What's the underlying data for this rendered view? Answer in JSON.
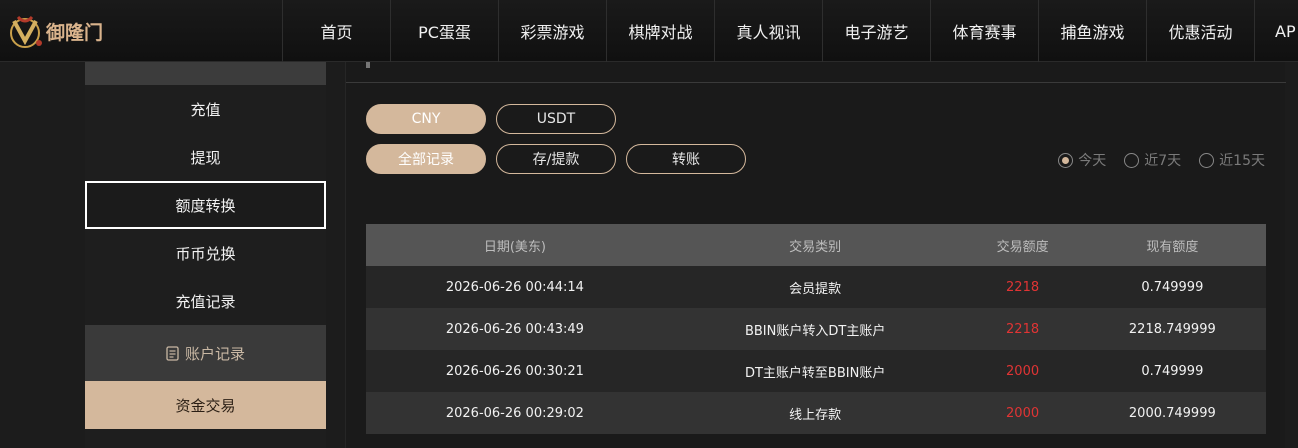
{
  "brand": {
    "name": "御隆门",
    "logo_icon": "brand-emblem-icon"
  },
  "nav": {
    "items": [
      "首页",
      "PC蛋蛋",
      "彩票游戏",
      "棋牌对战",
      "真人视讯",
      "电子游艺",
      "体育赛事",
      "捕鱼游戏",
      "优惠活动",
      "AP"
    ]
  },
  "sidebar": {
    "items": [
      "充值",
      "提现",
      "额度转换",
      "币币兑换",
      "充值记录"
    ],
    "section": {
      "label": "账户记录",
      "icon": "document-icon"
    },
    "section_items": [
      "资金交易"
    ]
  },
  "currency_tabs": [
    "CNY",
    "USDT"
  ],
  "filter_tabs": [
    "全部记录",
    "存/提款",
    "转账"
  ],
  "date_filters": [
    "今天",
    "近7天",
    "近15天"
  ],
  "table": {
    "columns": [
      "日期(美东)",
      "交易类别",
      "交易额度",
      "现有额度"
    ],
    "rows": [
      {
        "date": "2026-06-26 00:44:14",
        "type": "会员提款",
        "amount": "2218",
        "balance": "0.749999"
      },
      {
        "date": "2026-06-26 00:43:49",
        "type": "BBIN账户转入DT主账户",
        "amount": "2218",
        "balance": "2218.749999"
      },
      {
        "date": "2026-06-26 00:30:21",
        "type": "DT主账户转至BBIN账户",
        "amount": "2000",
        "balance": "0.749999"
      },
      {
        "date": "2026-06-26 00:29:02",
        "type": "线上存款",
        "amount": "2000",
        "balance": "2000.749999"
      }
    ]
  },
  "colors": {
    "accent": "#d4b89c",
    "amount": "#e03434"
  }
}
